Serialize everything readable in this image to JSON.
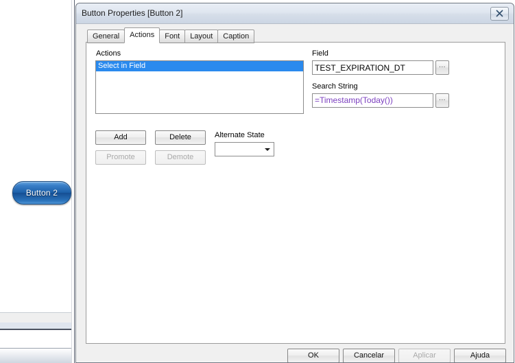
{
  "background": {
    "qv_button": {
      "label": "Button 2"
    }
  },
  "dialog": {
    "title": "Button Properties [Button 2]",
    "close_icon": "close-icon",
    "tabs": [
      {
        "label": "General",
        "active": false
      },
      {
        "label": "Actions",
        "active": true
      },
      {
        "label": "Font",
        "active": false
      },
      {
        "label": "Layout",
        "active": false
      },
      {
        "label": "Caption",
        "active": false
      }
    ],
    "actions_panel": {
      "actions_label": "Actions",
      "list_items": [
        {
          "label": "Select in Field",
          "selected": true
        }
      ],
      "buttons": {
        "add": "Add",
        "delete": "Delete",
        "promote": "Promote",
        "demote": "Demote"
      },
      "alternate_state": {
        "label": "Alternate State",
        "value": "",
        "arrow_icon": "chevron-down-icon"
      },
      "field": {
        "label": "Field",
        "value": "TEST_EXPIRATION_DT",
        "placeholder": "",
        "picker_label": "..."
      },
      "search_string": {
        "label": "Search String",
        "value": "=Timestamp(Today())",
        "value_head": "=Timestamp",
        "value_tail": "(Today())",
        "placeholder": "",
        "picker_label": "..."
      }
    },
    "footer": {
      "ok": "OK",
      "cancel": "Cancelar",
      "apply": "Aplicar",
      "help": "Ajuda"
    }
  },
  "colors": {
    "selection_blue": "#2a8aee",
    "expression_purple": "#7b3fbf",
    "button_blue": "#1c5fa8",
    "dialog_face": "#f0f0f0"
  }
}
